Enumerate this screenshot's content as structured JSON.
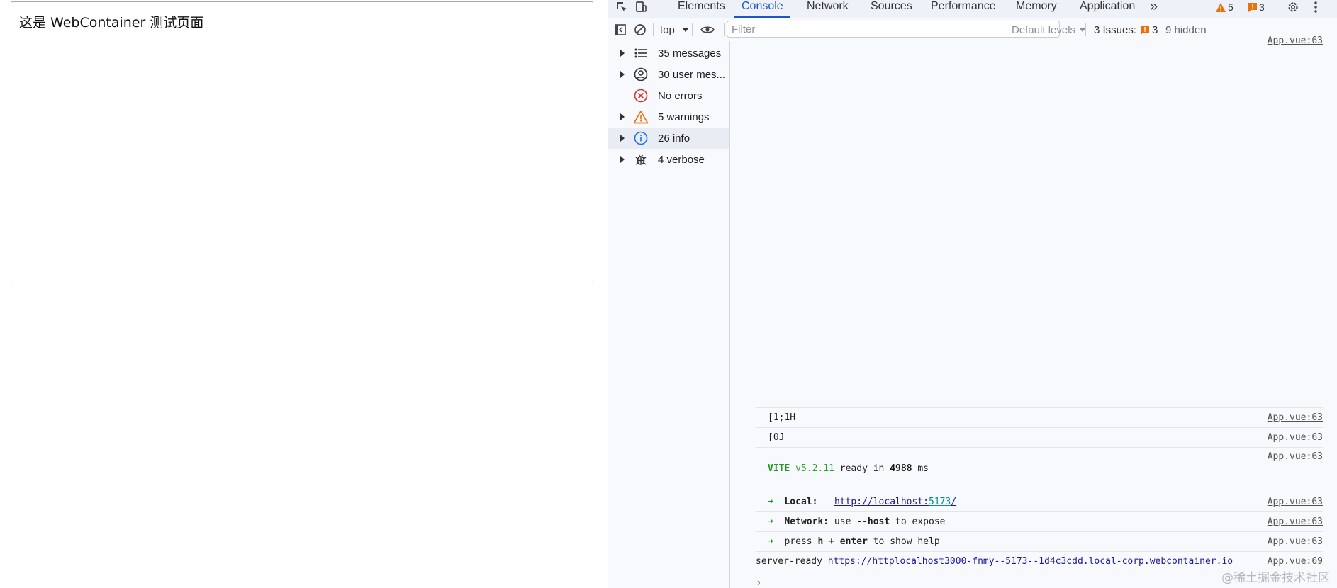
{
  "iframe": {
    "text": "这是 WebContainer 测试页面"
  },
  "devtools": {
    "tabs": [
      {
        "label": "Elements"
      },
      {
        "label": "Console"
      },
      {
        "label": "Network"
      },
      {
        "label": "Sources"
      },
      {
        "label": "Performance"
      },
      {
        "label": "Memory"
      },
      {
        "label": "Application"
      }
    ],
    "more_tabs": "»",
    "warnings_count": "5",
    "issues_count": "3"
  },
  "toolbar": {
    "context": "top",
    "filter_placeholder": "Filter",
    "levels": "Default levels",
    "issues_label": "3 Issues:",
    "issues_count": "3",
    "hidden": "9 hidden"
  },
  "sidebar": {
    "items": [
      {
        "label": "35 messages"
      },
      {
        "label": "30 user mes..."
      },
      {
        "label": "No errors"
      },
      {
        "label": "5 warnings"
      },
      {
        "label": "26 info"
      },
      {
        "label": "4 verbose"
      }
    ]
  },
  "console": {
    "top_src": "App.vue:63",
    "messages": [
      {
        "text": "[1;1H",
        "src": "App.vue:63"
      },
      {
        "text": "[0J",
        "src": "App.vue:63"
      },
      {
        "vite": "VITE",
        "version": "v5.2.11",
        "ready": " ready in ",
        "ms_value": "4988",
        "ms": " ms",
        "src": "App.vue:63"
      },
      {
        "arrow": "➜",
        "label": "Local:",
        "url_base": "http://localhost:",
        "url_port": "5173",
        "url_tail": "/",
        "src": "App.vue:63"
      },
      {
        "arrow": "➜",
        "label": "Network:",
        "pre": " use ",
        "flag": "--host",
        "post": " to expose",
        "src": "App.vue:63"
      },
      {
        "arrow": "➜",
        "pre": "press ",
        "key": "h + enter",
        "post": " to show help",
        "src": "App.vue:63"
      },
      {
        "pre": "server-ready ",
        "url": "https://httplocalhost3000-fnmy--5173--1d4c3cdd.local-corp.webcontainer.io",
        "src": "App.vue:69"
      }
    ],
    "prompt": "›"
  },
  "watermark": "@稀土掘金技术社区"
}
